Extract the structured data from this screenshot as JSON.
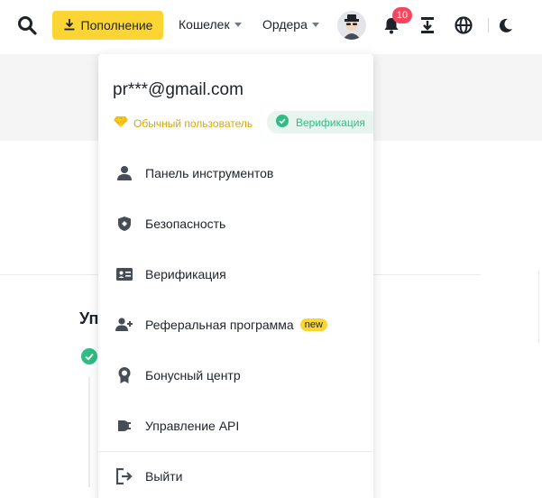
{
  "header": {
    "deposit_label": "Пополнение",
    "wallet_label": "Кошелек",
    "orders_label": "Ордера",
    "notification_count": "10"
  },
  "background": {
    "heading": "Уп"
  },
  "dropdown": {
    "email": "pr***@gmail.com",
    "user_type": "Обычный пользователь",
    "verification_status": "Верификация",
    "items": [
      {
        "label": "Панель инструментов",
        "icon": "user-icon"
      },
      {
        "label": "Безопасность",
        "icon": "shield-icon"
      },
      {
        "label": "Верификация",
        "icon": "id-card-icon"
      },
      {
        "label": "Реферальная программа",
        "icon": "add-user-icon",
        "tag": "new"
      },
      {
        "label": "Бонусный центр",
        "icon": "medal-icon"
      },
      {
        "label": "Управление API",
        "icon": "api-icon"
      }
    ],
    "logout_label": "Выйти"
  },
  "colors": {
    "accent": "#fcd535",
    "success": "#2ebd85",
    "badge": "#f6465d",
    "text": "#1e2329",
    "icon": "#474d57"
  }
}
